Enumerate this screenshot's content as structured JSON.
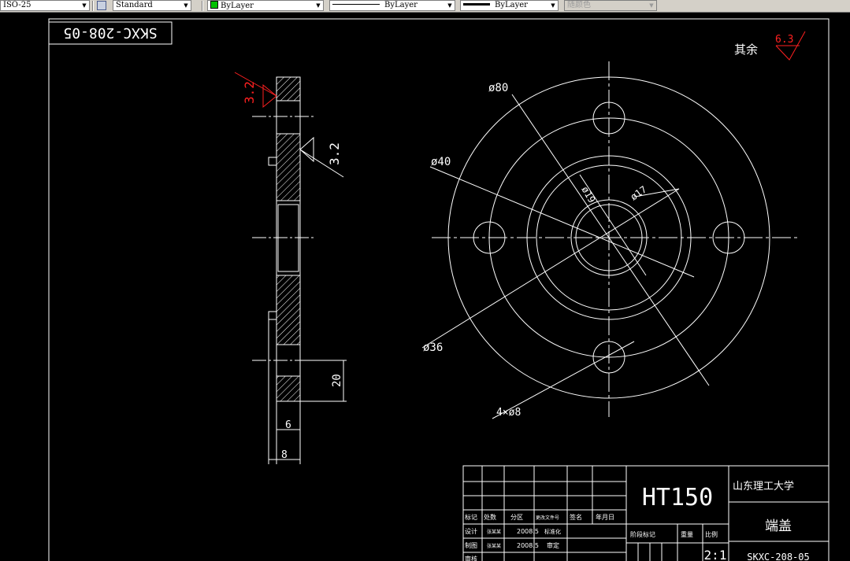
{
  "toolbar": {
    "dimstyle": "ISO-25",
    "textstyle": "Standard",
    "layer": "ByLayer",
    "layer_color": "#00c000",
    "linetype": "ByLayer",
    "lineweight": "ByLayer",
    "plotstyle": "随颜色"
  },
  "drawing": {
    "line_color": "#ffffff",
    "annotation_color": "#ff2020",
    "part_code_rotated": "SKXC-208-05",
    "surface_finish_label": "其余",
    "surface_finish_other": "6.3",
    "side_view": {
      "roughness_red": "3.2",
      "roughness_white": "3.2",
      "dim_height": "20",
      "dim_width_small": "6",
      "dim_width_large": "8"
    },
    "front_view": {
      "dim_d80": "ø80",
      "dim_d40": "ø40",
      "dim_d19": "ø19",
      "dim_d17": "ø17",
      "dim_d36": "ø36",
      "dim_holes": "4×ø8"
    },
    "title_block": {
      "material": "HT150",
      "school": "山东理工大学",
      "part_name": "端盖",
      "part_code": "SKXC-208-05",
      "scale": "2:1",
      "hdr_mark": "标记",
      "hdr_count": "处数",
      "hdr_zone": "分区",
      "hdr_change_doc": "更改文件号",
      "hdr_sign": "签名",
      "hdr_date": "年月日",
      "designer_label": "设计",
      "designer_name": "张某某",
      "designer_date": "2008.5",
      "standardize_label": "标准化",
      "drafter_label": "制图",
      "drafter_name": "张某某",
      "drafter_date": "2008.5",
      "review_label": "审定",
      "process_label": "审核",
      "stage_label": "阶段标记",
      "weight_label": "重量",
      "scale_label": "比例"
    }
  }
}
